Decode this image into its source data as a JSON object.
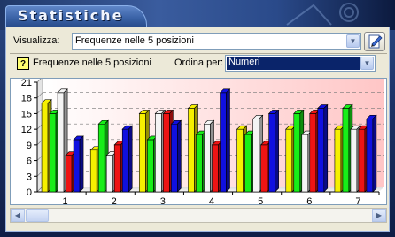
{
  "window": {
    "title": "Statistiche"
  },
  "toolbar": {
    "visualizza_label": "Visualizza:",
    "visualizza_value": "Frequenze nelle 5 posizioni"
  },
  "subheader": {
    "caption": "Frequenze nelle 5 posizioni",
    "ordina_label": "Ordina per:",
    "ordina_value": "Numeri"
  },
  "colors": {
    "yellow": "#f6f000",
    "green": "#18ee18",
    "white": "#f4f4f4",
    "red": "#ee1414",
    "blue": "#1010e0"
  },
  "chart_data": {
    "type": "bar",
    "categories": [
      "1",
      "2",
      "3",
      "4",
      "5",
      "6",
      "7"
    ],
    "ylim": [
      0,
      21
    ],
    "yticks": [
      0,
      3,
      6,
      9,
      12,
      15,
      18,
      21
    ],
    "grid": true,
    "legend": "none",
    "series": [
      {
        "color": "yellow",
        "values": [
          17,
          8,
          15,
          16,
          12,
          12,
          12
        ]
      },
      {
        "color": "green",
        "values": [
          15,
          13,
          10,
          11,
          11,
          15,
          16
        ]
      },
      {
        "color": "white",
        "values": [
          19,
          7,
          15,
          13,
          14,
          11,
          12
        ]
      },
      {
        "color": "red",
        "values": [
          7,
          9,
          15,
          9,
          9,
          15,
          12
        ]
      },
      {
        "color": "blue",
        "values": [
          10,
          12,
          13,
          19,
          15,
          16,
          14
        ]
      }
    ]
  }
}
